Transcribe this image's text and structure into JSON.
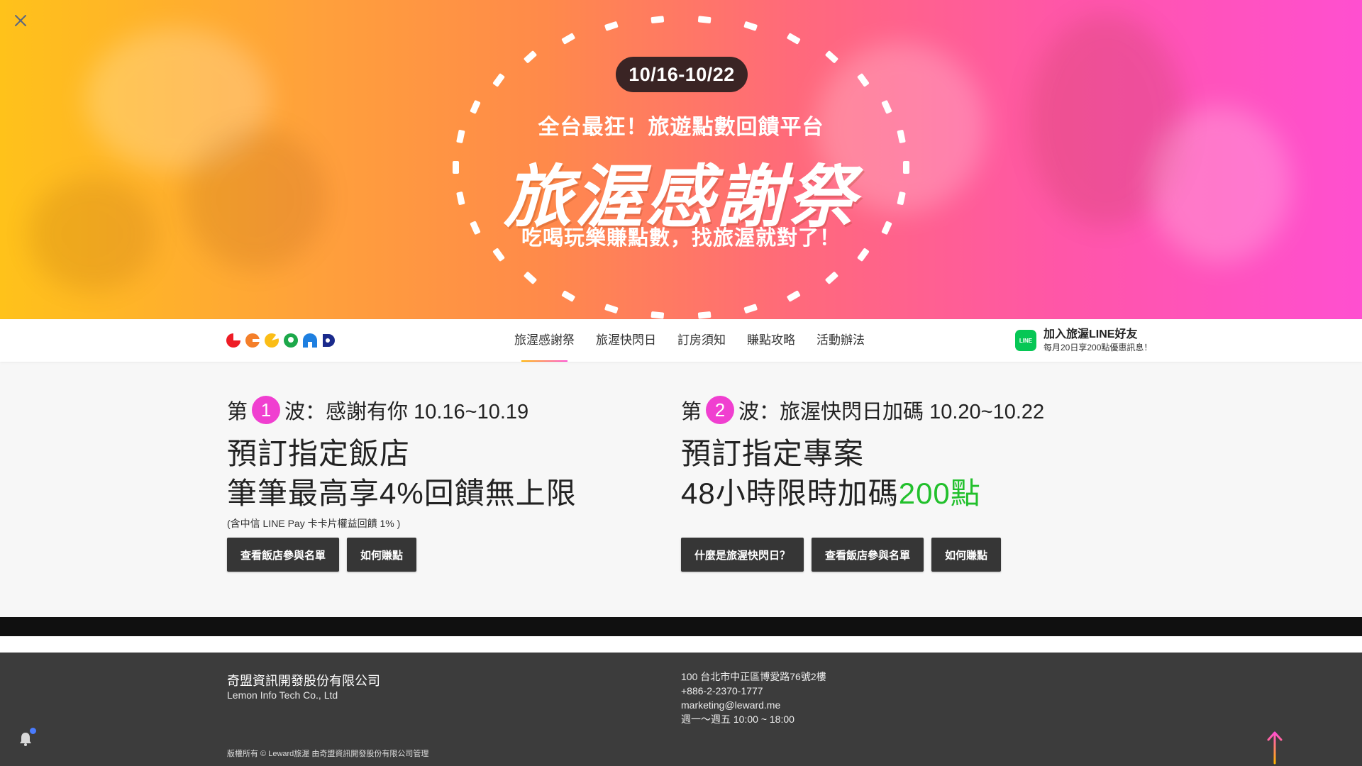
{
  "hero": {
    "date_range": "10/16-10/22",
    "subtitle": "全台最狂！旅遊點數回饋平台",
    "title": "旅渥感謝祭",
    "slogan": "吃喝玩樂賺點數，找旅渥就對了！",
    "close_icon": "close-icon"
  },
  "nav": {
    "logo_colors": [
      "#ee1c25",
      "#f47f2a",
      "#fbbd16",
      "#1ca84a",
      "#1e7fe0",
      "#1a2a8c"
    ],
    "items": [
      {
        "label": "旅渥感謝祭",
        "active": true
      },
      {
        "label": "旅渥快閃日",
        "active": false
      },
      {
        "label": "訂房須知",
        "active": false
      },
      {
        "label": "賺點攻略",
        "active": false
      },
      {
        "label": "活動辦法",
        "active": false
      }
    ],
    "line_cta": {
      "icon_text": "LINE",
      "title": "加入旅渥LINE好友",
      "desc": "每月20日享200點優惠訊息！"
    }
  },
  "wave1": {
    "prefix": "第",
    "number": "1",
    "suffix": "波：感謝有你 10.16~10.19",
    "line1": "預訂指定飯店",
    "line2": "筆筆最高享4%回饋無上限",
    "note": "(含中信 LINE Pay 卡卡片權益回饋 1% )",
    "buttons": [
      "查看飯店參與名單",
      "如何賺點"
    ]
  },
  "wave2": {
    "prefix": "第",
    "number": "2",
    "suffix": "波：旅渥快閃日加碼 10.20~10.22",
    "line1": "預訂指定專案",
    "line2_pre": "48小時限時加碼",
    "line2_highlight": "200點",
    "buttons": [
      "什麼是旅渥快閃日？",
      "查看飯店參與名單",
      "如何賺點"
    ]
  },
  "footer": {
    "company_zh": "奇盟資訊開發股份有限公司",
    "company_en": "Lemon Info Tech Co., Ltd",
    "address": "100 台北市中正區博愛路76號2樓",
    "phone": "+886-2-2370-1777",
    "email": "marketing@leward.me",
    "hours": "週一～週五 10:00 ~ 18:00",
    "copyright": "版權所有 © Leward旅渥 由奇盟資訊開發股份有限公司管理"
  },
  "colors": {
    "accent_pink": "#f03fd0",
    "highlight_green": "#22c02c",
    "button_dark": "#363636",
    "line_green": "#06c755"
  }
}
